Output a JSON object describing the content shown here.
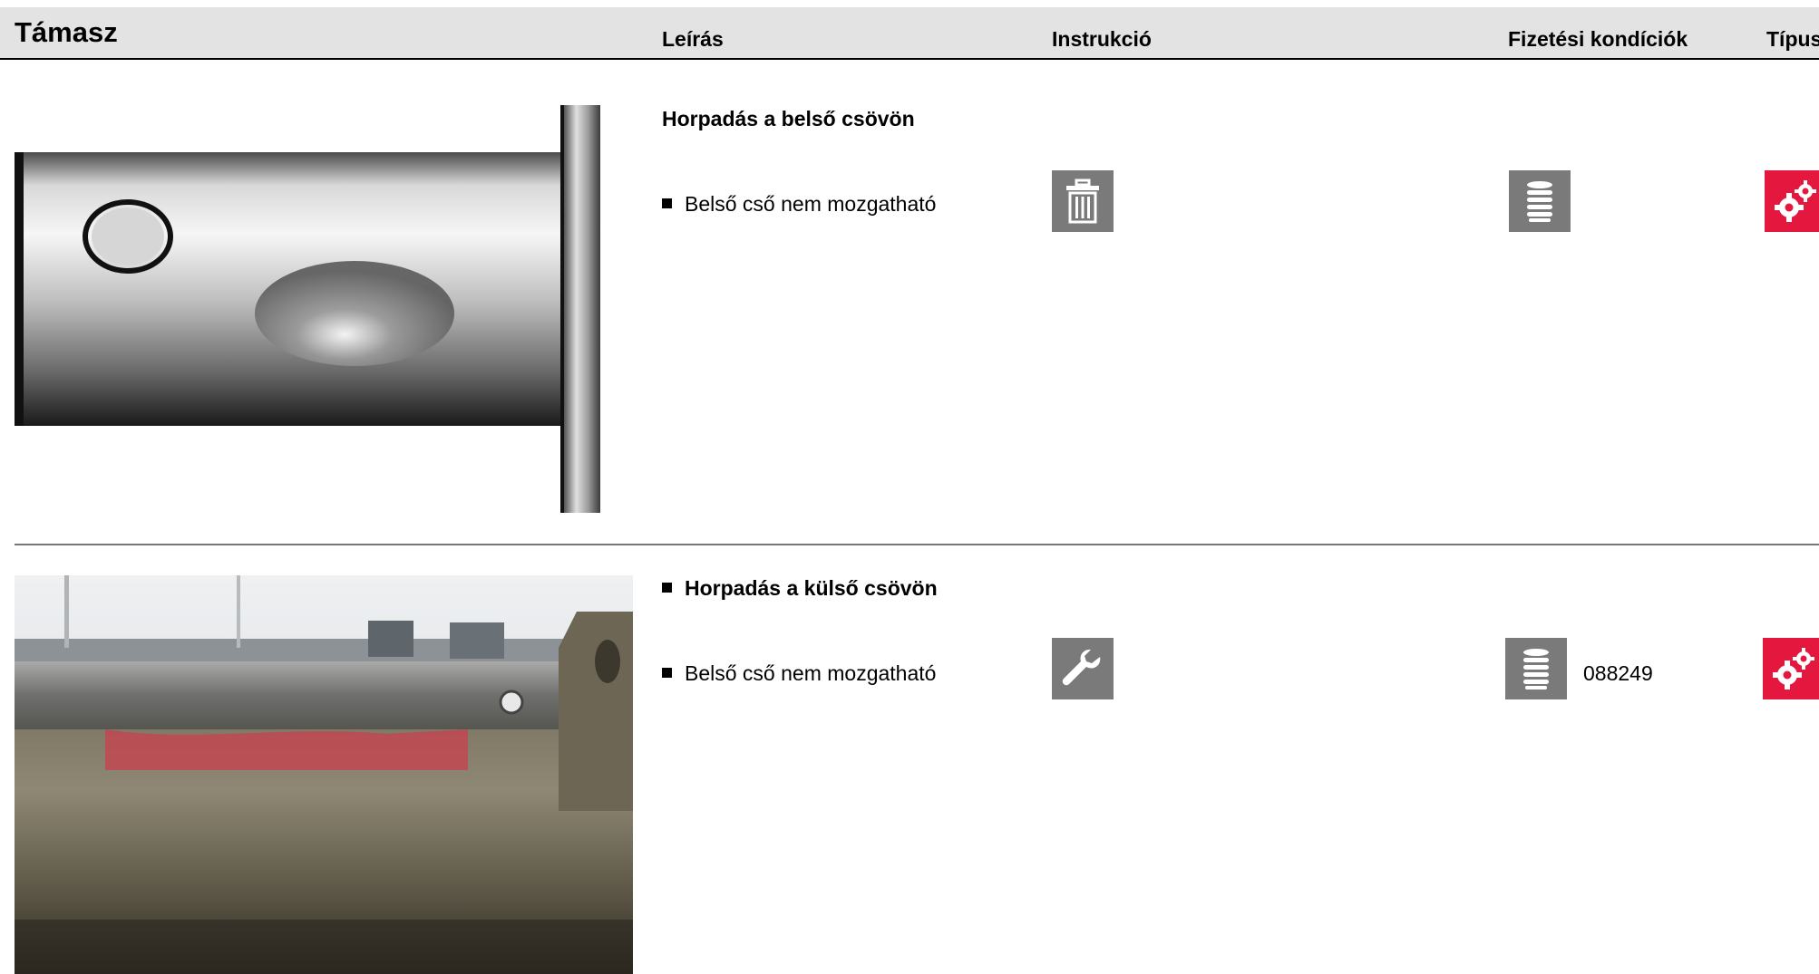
{
  "header": {
    "title": "Támasz",
    "columns": [
      "Leírás",
      "Instrukció",
      "Fizetési kondíciók",
      "Típus"
    ]
  },
  "rows": [
    {
      "title": "Horpadás a belső csövön",
      "item": "Belső cső nem mozgatható",
      "instruction_icon": "trash-icon",
      "payment_icon": "coin-stack-icon",
      "payment_code": "",
      "type_icon": "gears-icon"
    },
    {
      "title": "Horpadás a külső csövön",
      "item": "Belső cső nem mozgatható",
      "instruction_icon": "wrench-icon",
      "payment_icon": "coin-stack-icon",
      "payment_code": "088249",
      "type_icon": "gears-icon"
    }
  ],
  "colors": {
    "header_bg": "#e3e3e3",
    "icon_gray": "#7a7a7a",
    "icon_red": "#e4173e"
  }
}
